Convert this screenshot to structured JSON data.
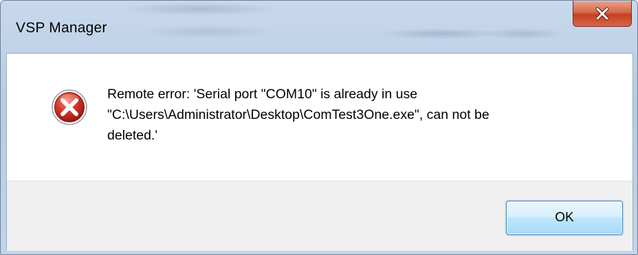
{
  "window": {
    "title": "VSP Manager",
    "close_icon": "close-icon"
  },
  "message": {
    "icon": "error-icon",
    "text": "Remote error: 'Serial port \"COM10\" is already in use\n\"C:\\Users\\Administrator\\Desktop\\ComTest3One.exe\", can not be\ndeleted.'"
  },
  "buttons": {
    "ok_label": "OK"
  },
  "colors": {
    "titlebar": "#b9cde5",
    "close_button": "#c9442a",
    "error_icon": "#c8261c",
    "footer": "#f0f0f0",
    "ok_border": "#3c7fb1"
  }
}
